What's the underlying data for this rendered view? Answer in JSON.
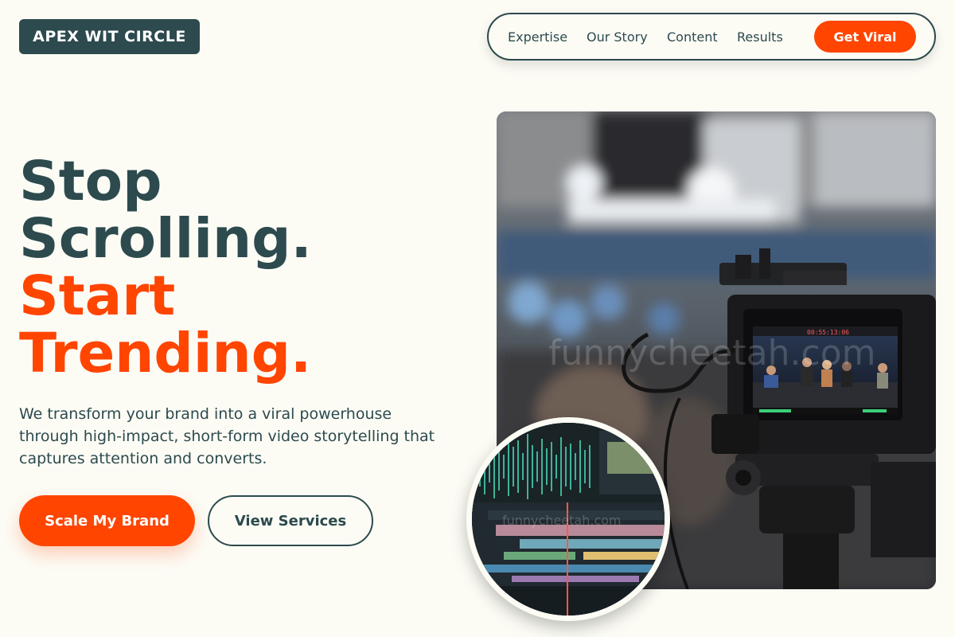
{
  "brand": {
    "name": "APEX WIT CIRCLE"
  },
  "nav": {
    "links": [
      "Expertise",
      "Our Story",
      "Content",
      "Results"
    ],
    "cta": "Get Viral"
  },
  "hero": {
    "headline_line1": "Stop",
    "headline_line2": "Scrolling.",
    "headline_line3": "Start",
    "headline_line4": "Trending.",
    "description": "We transform your brand into a viral powerhouse through high-impact, short-form video storytelling that captures attention and converts.",
    "primary_button": "Scale My Brand",
    "secondary_button": "View Services"
  },
  "media": {
    "main_photo_watermark": "funnycheetah.com",
    "camera_monitor_timecode": "00:55:13:06",
    "circle_photo_watermark": "funnycheetah.com"
  },
  "colors": {
    "primary_dark": "#2d4a4e",
    "accent": "#ff4500",
    "background": "#fcfcf5"
  }
}
